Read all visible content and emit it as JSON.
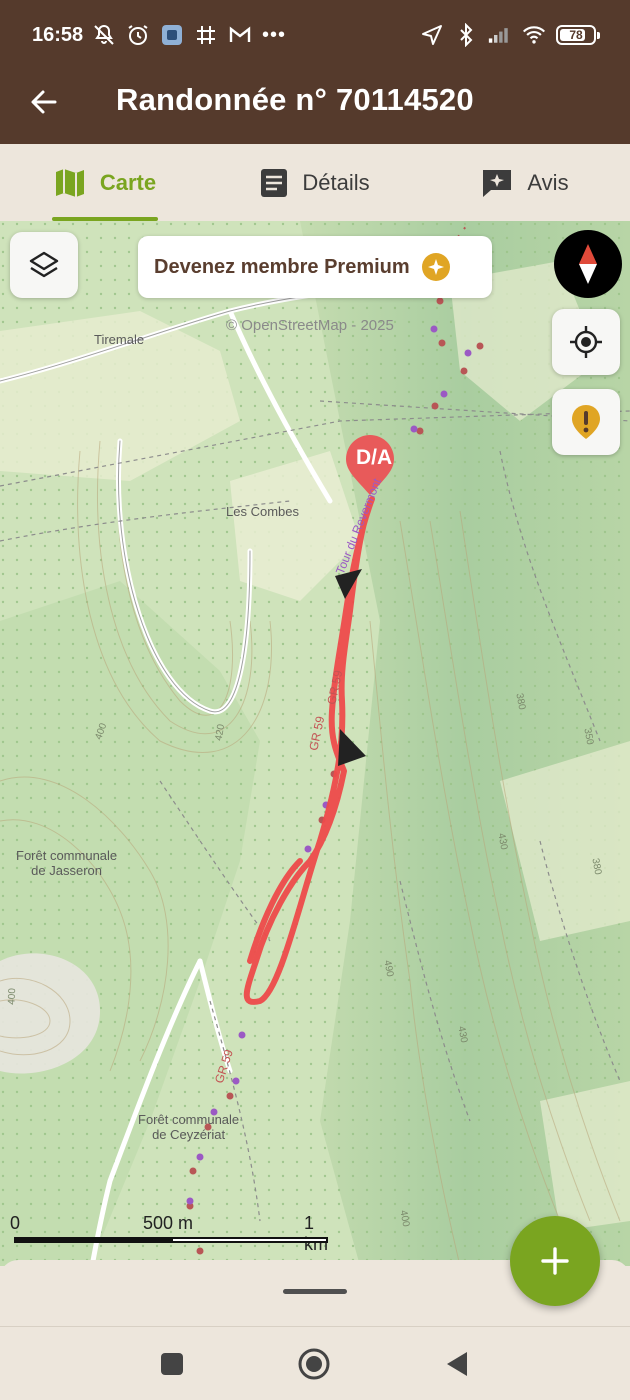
{
  "status_bar": {
    "time": "16:58",
    "battery": "78",
    "battery_level": 0.78,
    "overflow": "•••",
    "icons_left": [
      "mute-icon",
      "alarm-icon",
      "app-icon",
      "grid-icon",
      "gmail-icon"
    ],
    "icons_right": [
      "location-icon",
      "bluetooth-icon",
      "signal-icon",
      "wifi-icon",
      "battery-icon"
    ]
  },
  "app_bar": {
    "title": "Randonnée n° 70114520",
    "back_icon": "arrow-back-icon"
  },
  "tabs": [
    {
      "label": "Carte",
      "icon": "map-icon",
      "active": true
    },
    {
      "label": "Détails",
      "icon": "document-icon",
      "active": false
    },
    {
      "label": "Avis",
      "icon": "review-icon",
      "active": false
    }
  ],
  "map": {
    "premium_banner": "Devenez membre Premium",
    "attribution": "© OpenStreetMap - 2025",
    "marker": "D/A",
    "labels": {
      "tiremale": "Tiremale",
      "les_combes": "Les Combes",
      "foret_jasseron_1": "Forêt communale",
      "foret_jasseron_2": "de Jasseron",
      "foret_ceyzeriat_1": "Forêt communale",
      "foret_ceyzeriat_2": "de Ceyzériat",
      "trail_gr59_a": "GR 59",
      "trail_gr59_b": "GR 59",
      "trail_gr59_c": "GR 59",
      "trail_revermont": "Tour du Revermont"
    },
    "contours": {
      "c1": "400",
      "c2": "420",
      "c3": "380",
      "c4": "350",
      "c5": "490",
      "c6": "430",
      "c7": "430",
      "c8": "400",
      "c9": "380",
      "c10": "400"
    },
    "scale": {
      "zero": "0",
      "mid": "500 m",
      "end": "1 km"
    },
    "route_color": "#ee4b4b",
    "colors": {
      "accent": "#7aa520",
      "header": "#553a2c",
      "warning": "#e0a524"
    }
  },
  "fab_icon": "plus-icon",
  "nav": {
    "recents": "square-icon",
    "home": "circle-icon",
    "back": "triangle-back-icon"
  }
}
